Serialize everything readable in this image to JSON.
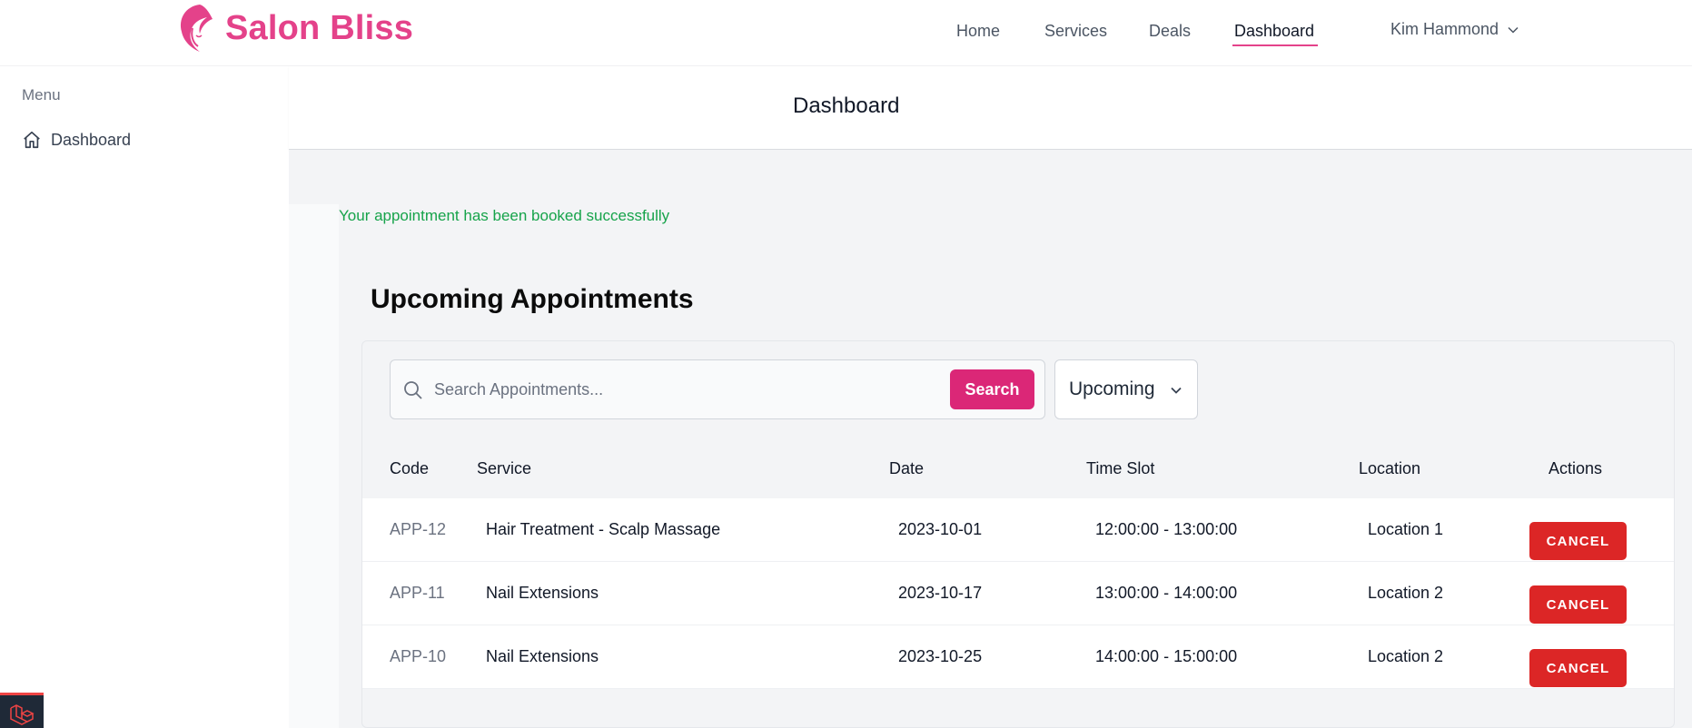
{
  "header": {
    "brand": "Salon Bliss",
    "nav": [
      "Home",
      "Services",
      "Deals",
      "Dashboard"
    ],
    "active_nav": "Dashboard",
    "user_name": "Kim Hammond"
  },
  "sidebar": {
    "menu_label": "Menu",
    "items": [
      {
        "label": "Dashboard",
        "icon": "home-icon"
      }
    ]
  },
  "page": {
    "title": "Dashboard",
    "success_message": "Your appointment has been booked successfully",
    "section_title": "Upcoming Appointments"
  },
  "search": {
    "placeholder": "Search Appointments...",
    "value": "",
    "button_label": "Search"
  },
  "filter": {
    "selected": "Upcoming"
  },
  "table": {
    "columns": [
      "Code",
      "Service",
      "Date",
      "Time Slot",
      "Location",
      "Actions"
    ],
    "rows": [
      {
        "code": "APP-12",
        "service": "Hair Treatment - Scalp Massage",
        "date": "2023-10-01",
        "time": "12:00:00 - 13:00:00",
        "location": "Location 1",
        "action": "CANCEL"
      },
      {
        "code": "APP-11",
        "service": "Nail Extensions",
        "date": "2023-10-17",
        "time": "13:00:00 - 14:00:00",
        "location": "Location 2",
        "action": "CANCEL"
      },
      {
        "code": "APP-10",
        "service": "Nail Extensions",
        "date": "2023-10-25",
        "time": "14:00:00 - 15:00:00",
        "location": "Location 2",
        "action": "CANCEL"
      }
    ]
  },
  "colors": {
    "brand_pink": "#e4428a",
    "search_button": "#db2777",
    "success_text": "#16a34a",
    "cancel_button": "#dc2626"
  }
}
